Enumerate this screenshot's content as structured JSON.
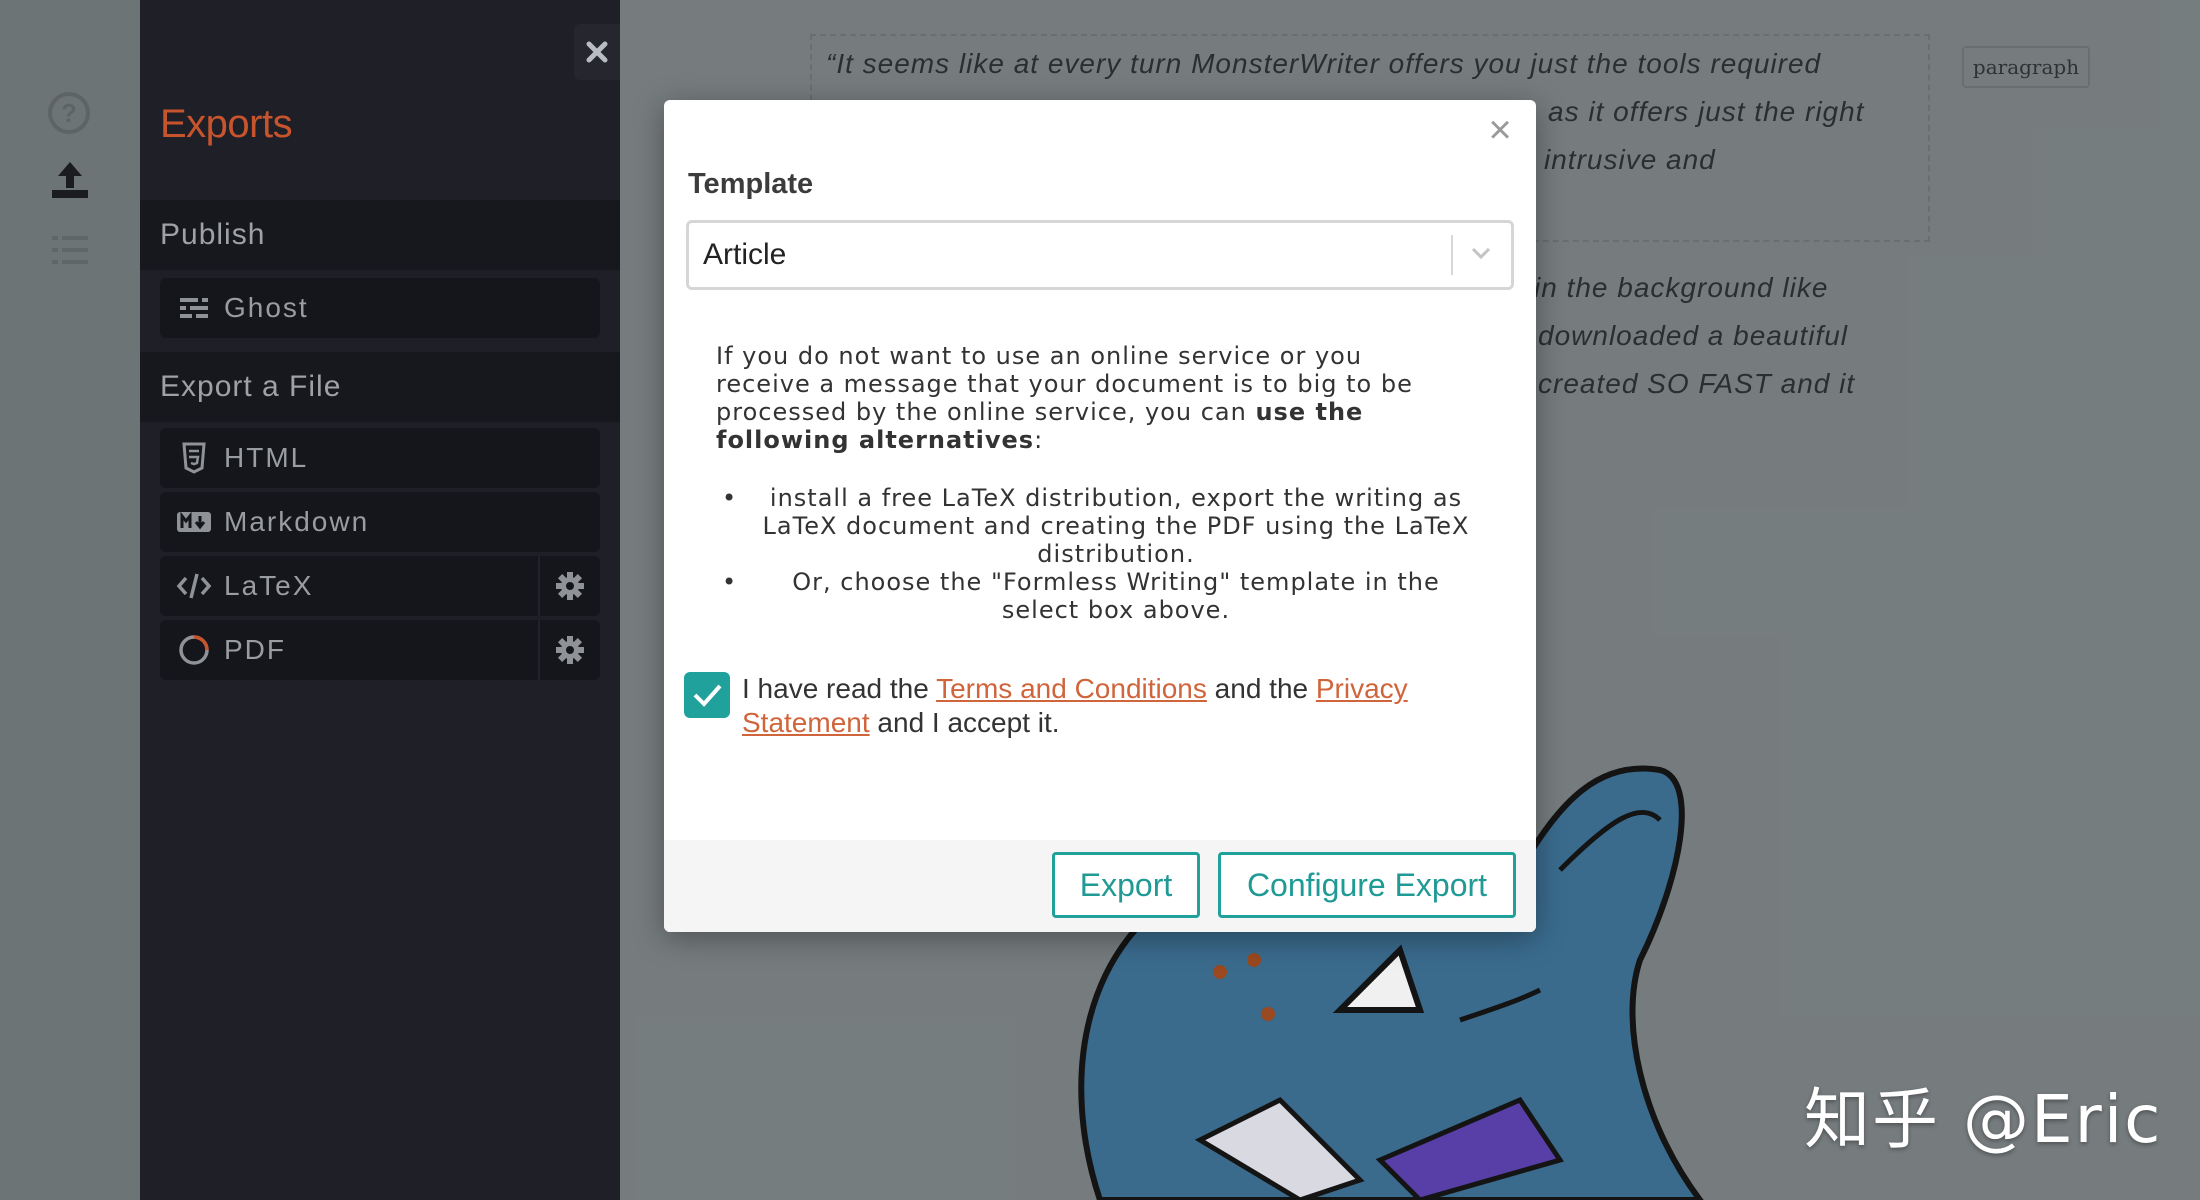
{
  "sidebar": {
    "title": "Exports",
    "publish_header": "Publish",
    "publish_items": [
      {
        "label": "Ghost",
        "icon": "ghost-icon"
      }
    ],
    "export_header": "Export a File",
    "export_items": [
      {
        "label": "HTML",
        "icon": "html5-icon"
      },
      {
        "label": "Markdown",
        "icon": "markdown-icon"
      },
      {
        "label": "LaTeX",
        "icon": "code-icon"
      },
      {
        "label": "PDF",
        "icon": "pdf-ring-icon"
      }
    ]
  },
  "editor": {
    "quote_lines": [
      "“It seems like at every turn MonsterWriter offers you just the tools required",
      "as it offers just the right",
      "intrusive and"
    ],
    "body_lines": [
      "in the background like",
      "downloaded a beautiful",
      "created SO FAST and it"
    ],
    "paragraph_tag": "paragraph"
  },
  "modal": {
    "template_label": "Template",
    "template_value": "Article",
    "info_text_1": "If you do not want to use an online service or you receive a message that your document is to big to be processed by the online service, you can ",
    "info_bold": "use the following alternatives",
    "info_text_2": ":",
    "bullets": [
      "install a free LaTeX distribution, export the writing as LaTeX document and creating the PDF using the LaTeX distribution.",
      "Or, choose the \"Formless Writing\" template in the select box above."
    ],
    "bullet_char": "•",
    "terms_prefix": "I have read the ",
    "terms_link": "Terms and Conditions",
    "terms_mid": " and the ",
    "privacy_link": "Privacy Statement",
    "terms_suffix": " and I accept it.",
    "checkbox_checked": true,
    "export_button": "Export",
    "configure_button": "Configure Export",
    "close_glyph": "×"
  },
  "watermark": "知乎 @Eric",
  "colors": {
    "accent": "#21a19b",
    "link": "#d0643b",
    "brand": "#c8542e",
    "sidebar_bg": "#1e1f27"
  }
}
